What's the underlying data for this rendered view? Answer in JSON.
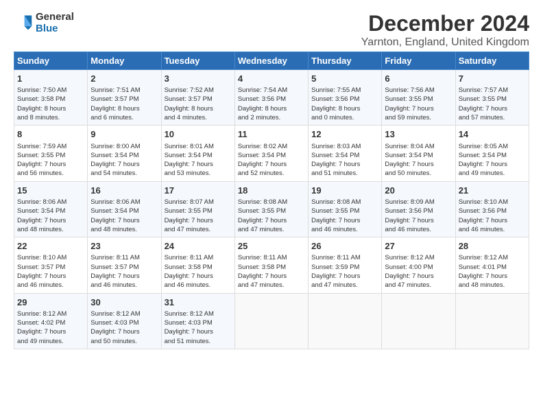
{
  "header": {
    "logo_line1": "General",
    "logo_line2": "Blue",
    "title": "December 2024",
    "subtitle": "Yarnton, England, United Kingdom"
  },
  "days_of_week": [
    "Sunday",
    "Monday",
    "Tuesday",
    "Wednesday",
    "Thursday",
    "Friday",
    "Saturday"
  ],
  "weeks": [
    [
      {
        "day": 1,
        "lines": [
          "Sunrise: 7:50 AM",
          "Sunset: 3:58 PM",
          "Daylight: 8 hours",
          "and 8 minutes."
        ]
      },
      {
        "day": 2,
        "lines": [
          "Sunrise: 7:51 AM",
          "Sunset: 3:57 PM",
          "Daylight: 8 hours",
          "and 6 minutes."
        ]
      },
      {
        "day": 3,
        "lines": [
          "Sunrise: 7:52 AM",
          "Sunset: 3:57 PM",
          "Daylight: 8 hours",
          "and 4 minutes."
        ]
      },
      {
        "day": 4,
        "lines": [
          "Sunrise: 7:54 AM",
          "Sunset: 3:56 PM",
          "Daylight: 8 hours",
          "and 2 minutes."
        ]
      },
      {
        "day": 5,
        "lines": [
          "Sunrise: 7:55 AM",
          "Sunset: 3:56 PM",
          "Daylight: 8 hours",
          "and 0 minutes."
        ]
      },
      {
        "day": 6,
        "lines": [
          "Sunrise: 7:56 AM",
          "Sunset: 3:55 PM",
          "Daylight: 7 hours",
          "and 59 minutes."
        ]
      },
      {
        "day": 7,
        "lines": [
          "Sunrise: 7:57 AM",
          "Sunset: 3:55 PM",
          "Daylight: 7 hours",
          "and 57 minutes."
        ]
      }
    ],
    [
      {
        "day": 8,
        "lines": [
          "Sunrise: 7:59 AM",
          "Sunset: 3:55 PM",
          "Daylight: 7 hours",
          "and 56 minutes."
        ]
      },
      {
        "day": 9,
        "lines": [
          "Sunrise: 8:00 AM",
          "Sunset: 3:54 PM",
          "Daylight: 7 hours",
          "and 54 minutes."
        ]
      },
      {
        "day": 10,
        "lines": [
          "Sunrise: 8:01 AM",
          "Sunset: 3:54 PM",
          "Daylight: 7 hours",
          "and 53 minutes."
        ]
      },
      {
        "day": 11,
        "lines": [
          "Sunrise: 8:02 AM",
          "Sunset: 3:54 PM",
          "Daylight: 7 hours",
          "and 52 minutes."
        ]
      },
      {
        "day": 12,
        "lines": [
          "Sunrise: 8:03 AM",
          "Sunset: 3:54 PM",
          "Daylight: 7 hours",
          "and 51 minutes."
        ]
      },
      {
        "day": 13,
        "lines": [
          "Sunrise: 8:04 AM",
          "Sunset: 3:54 PM",
          "Daylight: 7 hours",
          "and 50 minutes."
        ]
      },
      {
        "day": 14,
        "lines": [
          "Sunrise: 8:05 AM",
          "Sunset: 3:54 PM",
          "Daylight: 7 hours",
          "and 49 minutes."
        ]
      }
    ],
    [
      {
        "day": 15,
        "lines": [
          "Sunrise: 8:06 AM",
          "Sunset: 3:54 PM",
          "Daylight: 7 hours",
          "and 48 minutes."
        ]
      },
      {
        "day": 16,
        "lines": [
          "Sunrise: 8:06 AM",
          "Sunset: 3:54 PM",
          "Daylight: 7 hours",
          "and 48 minutes."
        ]
      },
      {
        "day": 17,
        "lines": [
          "Sunrise: 8:07 AM",
          "Sunset: 3:55 PM",
          "Daylight: 7 hours",
          "and 47 minutes."
        ]
      },
      {
        "day": 18,
        "lines": [
          "Sunrise: 8:08 AM",
          "Sunset: 3:55 PM",
          "Daylight: 7 hours",
          "and 47 minutes."
        ]
      },
      {
        "day": 19,
        "lines": [
          "Sunrise: 8:08 AM",
          "Sunset: 3:55 PM",
          "Daylight: 7 hours",
          "and 46 minutes."
        ]
      },
      {
        "day": 20,
        "lines": [
          "Sunrise: 8:09 AM",
          "Sunset: 3:56 PM",
          "Daylight: 7 hours",
          "and 46 minutes."
        ]
      },
      {
        "day": 21,
        "lines": [
          "Sunrise: 8:10 AM",
          "Sunset: 3:56 PM",
          "Daylight: 7 hours",
          "and 46 minutes."
        ]
      }
    ],
    [
      {
        "day": 22,
        "lines": [
          "Sunrise: 8:10 AM",
          "Sunset: 3:57 PM",
          "Daylight: 7 hours",
          "and 46 minutes."
        ]
      },
      {
        "day": 23,
        "lines": [
          "Sunrise: 8:11 AM",
          "Sunset: 3:57 PM",
          "Daylight: 7 hours",
          "and 46 minutes."
        ]
      },
      {
        "day": 24,
        "lines": [
          "Sunrise: 8:11 AM",
          "Sunset: 3:58 PM",
          "Daylight: 7 hours",
          "and 46 minutes."
        ]
      },
      {
        "day": 25,
        "lines": [
          "Sunrise: 8:11 AM",
          "Sunset: 3:58 PM",
          "Daylight: 7 hours",
          "and 47 minutes."
        ]
      },
      {
        "day": 26,
        "lines": [
          "Sunrise: 8:11 AM",
          "Sunset: 3:59 PM",
          "Daylight: 7 hours",
          "and 47 minutes."
        ]
      },
      {
        "day": 27,
        "lines": [
          "Sunrise: 8:12 AM",
          "Sunset: 4:00 PM",
          "Daylight: 7 hours",
          "and 47 minutes."
        ]
      },
      {
        "day": 28,
        "lines": [
          "Sunrise: 8:12 AM",
          "Sunset: 4:01 PM",
          "Daylight: 7 hours",
          "and 48 minutes."
        ]
      }
    ],
    [
      {
        "day": 29,
        "lines": [
          "Sunrise: 8:12 AM",
          "Sunset: 4:02 PM",
          "Daylight: 7 hours",
          "and 49 minutes."
        ]
      },
      {
        "day": 30,
        "lines": [
          "Sunrise: 8:12 AM",
          "Sunset: 4:03 PM",
          "Daylight: 7 hours",
          "and 50 minutes."
        ]
      },
      {
        "day": 31,
        "lines": [
          "Sunrise: 8:12 AM",
          "Sunset: 4:03 PM",
          "Daylight: 7 hours",
          "and 51 minutes."
        ]
      },
      null,
      null,
      null,
      null
    ]
  ]
}
